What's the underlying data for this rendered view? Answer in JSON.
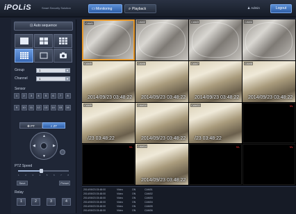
{
  "header": {
    "logo": "iPOLiS",
    "logo_sub": "Smart Security Solution",
    "tab_monitoring": "Monitoring",
    "tab_playback": "Playback",
    "user": "Admin",
    "logout": "Logout"
  },
  "sidebar": {
    "sequence_btn": "Auto sequence",
    "group_label": "Group",
    "group_value": "1",
    "channel_label": "Channel",
    "channel_value": "1",
    "sensor_label": "Sensor",
    "numbers": [
      "1",
      "2",
      "3",
      "4",
      "5",
      "6",
      "7",
      "8",
      "9",
      "10",
      "11",
      "12",
      "13",
      "14",
      "15",
      "16"
    ],
    "pt_tab": "PT",
    "ptz_tab": "ZT",
    "ptz_speed_label": "PTZ Speed",
    "ptz_speed": 0.45,
    "speed_scale": [
      "1",
      "2",
      "3",
      "4",
      "5",
      "6",
      "7",
      "8"
    ],
    "btn_save": "Save",
    "btn_preset": "Preset",
    "relay_label": "Relay",
    "relay_buttons": [
      "1",
      "2",
      "3",
      "4"
    ]
  },
  "tiles": [
    {
      "type": "cam",
      "name": "CAM1",
      "ts": "",
      "ind": "",
      "selected": true
    },
    {
      "type": "cam",
      "name": "CAM2",
      "ts": "",
      "ind": ""
    },
    {
      "type": "cam",
      "name": "CAM3",
      "ts": "",
      "ind": ""
    },
    {
      "type": "cam",
      "name": "CAM4",
      "ts": "",
      "ind": ""
    },
    {
      "type": "room",
      "name": "CAM5",
      "ts": "2014/09/23 03:48:22",
      "ind": ""
    },
    {
      "type": "room",
      "name": "CAM6",
      "ts": "2014/09/23 03:48:22",
      "ind": ""
    },
    {
      "type": "room",
      "name": "CAM7",
      "ts": "2014/09/23 03:48:22",
      "ind": ""
    },
    {
      "type": "room",
      "name": "CAM8",
      "ts": "2014/09/23 03:48:22",
      "ind": ""
    },
    {
      "type": "room",
      "name": "CAM9",
      "ts": "/23 03:48:22",
      "ind": ""
    },
    {
      "type": "room",
      "name": "CAM10",
      "ts": "2014/09/23 03:48:22",
      "ind": ""
    },
    {
      "type": "room",
      "name": "CAM11",
      "ts": "/23 03:48:22",
      "ind": ""
    },
    {
      "type": "empty",
      "name": "",
      "ts": "",
      "ind": "VL"
    },
    {
      "type": "empty",
      "name": "",
      "ts": "",
      "ind": "VL"
    },
    {
      "type": "room",
      "name": "CAM14",
      "ts": "2014/09/23 03:48:22",
      "ind": ""
    },
    {
      "type": "empty",
      "name": "",
      "ts": "",
      "ind": "VL"
    },
    {
      "type": "empty",
      "name": "",
      "ts": "",
      "ind": "VL"
    }
  ],
  "log_rows": [
    [
      "2014/09/23 03:48:00",
      "Video",
      "ON",
      "CAM01"
    ],
    [
      "2014/09/23 03:48:00",
      "Video",
      "ON",
      "CAM02"
    ],
    [
      "2014/09/23 03:48:00",
      "Video",
      "ON",
      "CAM03"
    ],
    [
      "2014/09/23 03:48:00",
      "Video",
      "ON",
      "CAM04"
    ],
    [
      "2014/09/23 03:48:00",
      "Video",
      "ON",
      "CAM05"
    ],
    [
      "2014/09/23 03:48:00",
      "Video",
      "ON",
      "CAM06"
    ]
  ],
  "colors": {
    "accent": "#2f5fa8",
    "selected": "#e89a2c",
    "alarm": "#e03030"
  }
}
